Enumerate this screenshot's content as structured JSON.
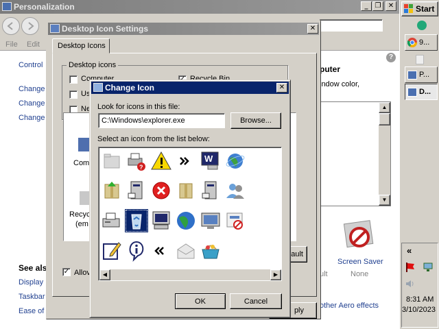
{
  "personalization": {
    "title": "Personalization",
    "menu": [
      "File",
      "Edit"
    ],
    "links": [
      "Control",
      "Change",
      "Change",
      "Change"
    ],
    "see_also_heading": "See als",
    "see_also": [
      "Display",
      "Taskbar",
      "Ease of"
    ],
    "heading_right": "puter",
    "text_right": "indow color,",
    "screensaver_label": "Screen Saver",
    "screensaver_value": "None",
    "fragment_ult": "ult",
    "aero_text": "other Aero effects",
    "help_glyph": "?"
  },
  "desktop_icon_settings": {
    "title": "Desktop Icon Settings",
    "tab": "Desktop Icons",
    "group": "Desktop icons",
    "checkboxes": [
      {
        "label": "Computer",
        "checked": false
      },
      {
        "label": "Us",
        "checked": false
      },
      {
        "label": "Ne",
        "checked": false
      },
      {
        "label": "Recycle Bin",
        "checked": true
      }
    ],
    "preview_labels": [
      "Comp",
      "Recyc",
      "(em"
    ],
    "allow_label": "Allov",
    "allow_checked": true,
    "default_fragment": "ault",
    "apply_fragment": "ply"
  },
  "change_icon": {
    "title": "Change Icon",
    "look_label": "Look for icons in this file:",
    "file_value": "C:\\Windows\\explorer.exe",
    "browse": "Browse...",
    "select_label": "Select an icon from the list below:",
    "ok": "OK",
    "cancel": "Cancel",
    "icons": [
      "folder-icon",
      "printer-help-icon",
      "warning-icon",
      "double-chevron-right-icon",
      "monitor-w-icon",
      "globe-icon",
      "folder-zip-icon",
      "computer-tower-icon",
      "error-icon",
      "folder-zip-2-icon",
      "computer-tower-2-icon",
      "users-icon",
      "fax-icon",
      "recycle-bin-icon",
      "computer-monitor-icon",
      "globe-2-icon",
      "monitor-display-icon",
      "no-image-icon",
      "note-edit-icon",
      "info-icon",
      "double-chevron-left-icon",
      "envelope-icon",
      "basket-icon"
    ],
    "selected_index": 13
  },
  "taskbar": {
    "start": "Start",
    "tasks": [
      {
        "label": "9...",
        "icon": "chrome-icon"
      },
      {
        "label": "P...",
        "icon": "window-icon"
      },
      {
        "label": "D...",
        "icon": "window-icon"
      }
    ],
    "tray_chevron": "«",
    "time": "8:31 AM",
    "date": "3/10/2023"
  }
}
